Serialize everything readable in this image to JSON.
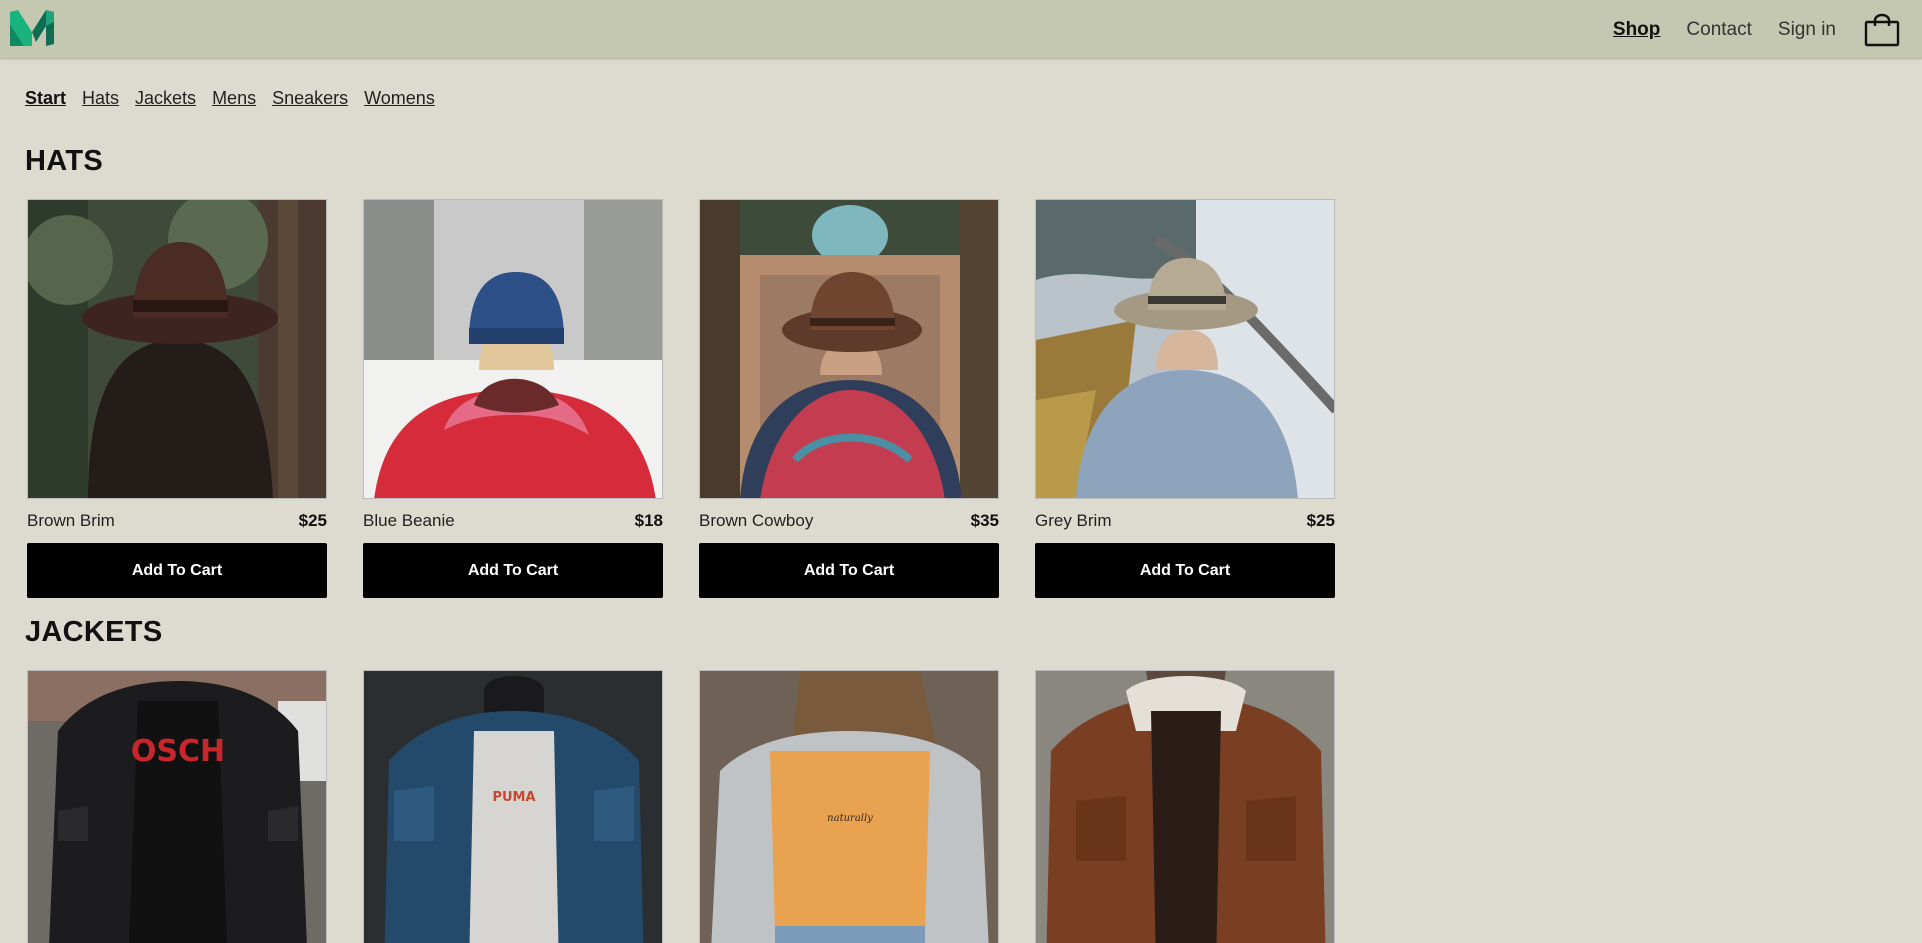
{
  "header": {
    "logo_name": "brand-logo",
    "nav": [
      {
        "label": "Shop",
        "active": true
      },
      {
        "label": "Contact",
        "active": false
      },
      {
        "label": "Sign in",
        "active": false
      }
    ],
    "bag_icon": "shopping-bag-icon"
  },
  "categories": [
    {
      "label": "Start",
      "active": true
    },
    {
      "label": "Hats",
      "active": false
    },
    {
      "label": "Jackets",
      "active": false
    },
    {
      "label": "Mens",
      "active": false
    },
    {
      "label": "Sneakers",
      "active": false
    },
    {
      "label": "Womens",
      "active": false
    }
  ],
  "sections": [
    {
      "title": "HATS",
      "products": [
        {
          "name": "Brown Brim",
          "price": "$25",
          "button": "Add To Cart"
        },
        {
          "name": "Blue Beanie",
          "price": "$18",
          "button": "Add To Cart"
        },
        {
          "name": "Brown Cowboy",
          "price": "$35",
          "button": "Add To Cart"
        },
        {
          "name": "Grey Brim",
          "price": "$25",
          "button": "Add To Cart"
        }
      ]
    },
    {
      "title": "JACKETS",
      "products": [
        {
          "name": "",
          "price": "",
          "button": ""
        },
        {
          "name": "",
          "price": "",
          "button": ""
        },
        {
          "name": "",
          "price": "",
          "button": ""
        },
        {
          "name": "",
          "price": "",
          "button": ""
        }
      ]
    }
  ],
  "colors": {
    "background": "#dddbcf",
    "header": "#c4c8b0",
    "logo_green": "#1fa37a",
    "logo_dark": "#0c5f4a",
    "button": "#000000"
  }
}
